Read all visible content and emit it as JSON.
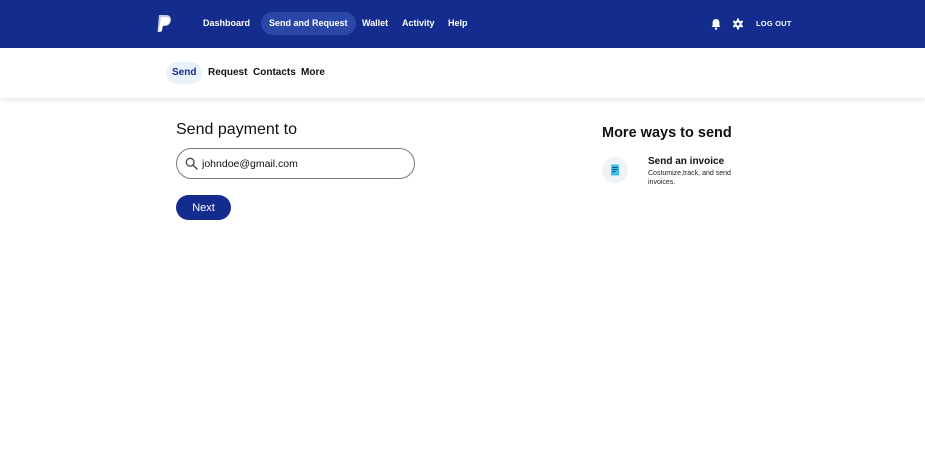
{
  "topnav": {
    "logo_icon": "paypal-logo-icon",
    "items": [
      {
        "label": "Dashboard"
      },
      {
        "label": "Send and Request"
      },
      {
        "label": "Wallet"
      },
      {
        "label": "Activity"
      },
      {
        "label": "Help"
      }
    ],
    "active_item": "Send and Request",
    "notification_icon": "bell-icon",
    "settings_icon": "gear-icon",
    "logout_label": "LOG OUT",
    "background_color": "#142c8e"
  },
  "subnav": {
    "items": [
      {
        "label": "Send"
      },
      {
        "label": "Request"
      },
      {
        "label": "Contacts"
      },
      {
        "label": "More"
      }
    ],
    "active_item": "Send"
  },
  "main": {
    "heading": "Send payment to",
    "search": {
      "icon": "search-icon",
      "value": "johndoe@gmail.com"
    },
    "next_label": "Next"
  },
  "sidebar": {
    "title": "More ways to send",
    "options": [
      {
        "icon": "invoice-icon",
        "title": "Send an invoice",
        "description": "Costumize,track, and send invoices."
      }
    ]
  }
}
